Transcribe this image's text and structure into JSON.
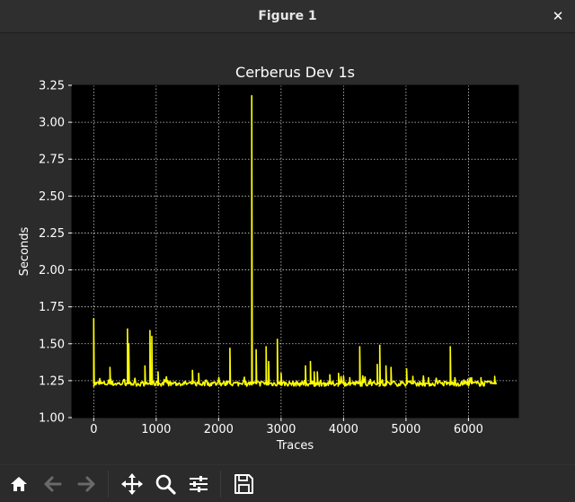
{
  "window": {
    "title": "Figure 1",
    "close_label": "✕"
  },
  "toolbar": {
    "icons": [
      "home-icon",
      "back-arrow-icon",
      "forward-arrow-icon",
      "pan-icon",
      "zoom-icon",
      "configure-subplots-icon",
      "save-icon"
    ]
  },
  "colors": {
    "background": "#2b2b2b",
    "axes_background": "#000000",
    "line": "#ffff00",
    "text": "#ffffff",
    "grid": "#ffffff"
  },
  "chart_data": {
    "type": "line",
    "title": "Cerberus Dev 1s",
    "xlabel": "Traces",
    "ylabel": "Seconds",
    "xlim": [
      -350,
      6800
    ],
    "ylim": [
      1.0,
      3.25
    ],
    "xticks": [
      0,
      1000,
      2000,
      3000,
      4000,
      5000,
      6000
    ],
    "xtick_labels": [
      "0",
      "1000",
      "2000",
      "3000",
      "4000",
      "5000",
      "6000"
    ],
    "yticks": [
      1.0,
      1.25,
      1.5,
      1.75,
      2.0,
      2.25,
      2.5,
      2.75,
      3.0,
      3.25
    ],
    "ytick_labels": [
      "1.00",
      "1.25",
      "1.50",
      "1.75",
      "2.00",
      "2.25",
      "2.50",
      "2.75",
      "3.00",
      "3.25"
    ],
    "grid": true,
    "series": [
      {
        "color": "#ffff00",
        "baseline": 1.23,
        "x_range": [
          0,
          6450
        ],
        "spikes": [
          {
            "x": 0,
            "y": 1.67
          },
          {
            "x": 260,
            "y": 1.34
          },
          {
            "x": 540,
            "y": 1.6
          },
          {
            "x": 560,
            "y": 1.5
          },
          {
            "x": 820,
            "y": 1.35
          },
          {
            "x": 900,
            "y": 1.59
          },
          {
            "x": 930,
            "y": 1.55
          },
          {
            "x": 1030,
            "y": 1.31
          },
          {
            "x": 1580,
            "y": 1.32
          },
          {
            "x": 1680,
            "y": 1.3
          },
          {
            "x": 2180,
            "y": 1.47
          },
          {
            "x": 2530,
            "y": 3.18
          },
          {
            "x": 2600,
            "y": 1.46
          },
          {
            "x": 2760,
            "y": 1.48
          },
          {
            "x": 2800,
            "y": 1.38
          },
          {
            "x": 2940,
            "y": 1.53
          },
          {
            "x": 3000,
            "y": 1.3
          },
          {
            "x": 3390,
            "y": 1.35
          },
          {
            "x": 3470,
            "y": 1.38
          },
          {
            "x": 3530,
            "y": 1.31
          },
          {
            "x": 3580,
            "y": 1.31
          },
          {
            "x": 3780,
            "y": 1.29
          },
          {
            "x": 3920,
            "y": 1.3
          },
          {
            "x": 4000,
            "y": 1.28
          },
          {
            "x": 4100,
            "y": 1.27
          },
          {
            "x": 4260,
            "y": 1.48
          },
          {
            "x": 4540,
            "y": 1.36
          },
          {
            "x": 4580,
            "y": 1.49
          },
          {
            "x": 4680,
            "y": 1.35
          },
          {
            "x": 4760,
            "y": 1.34
          },
          {
            "x": 5010,
            "y": 1.33
          },
          {
            "x": 5110,
            "y": 1.28
          },
          {
            "x": 5360,
            "y": 1.27
          },
          {
            "x": 5710,
            "y": 1.48
          },
          {
            "x": 6050,
            "y": 1.27
          },
          {
            "x": 6200,
            "y": 1.27
          },
          {
            "x": 6420,
            "y": 1.28
          }
        ]
      }
    ]
  }
}
